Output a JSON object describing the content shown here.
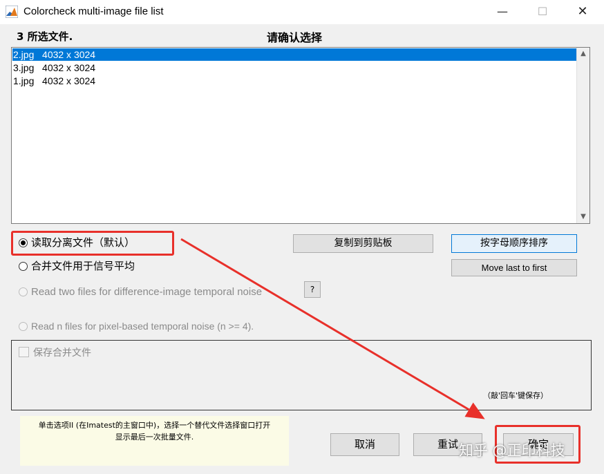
{
  "window": {
    "title": "Colorcheck  multi-image file list",
    "minimize_glyph": "—",
    "maximize_glyph": "☐",
    "close_glyph": "✕"
  },
  "header": {
    "file_count": "3 所选文件.",
    "confirm_title": "请确认选择"
  },
  "file_list": {
    "items": [
      "2.jpg   4032 x 3024",
      "3.jpg   4032 x 3024",
      "1.jpg   4032 x 3024"
    ],
    "selected_index": 0
  },
  "options": {
    "read_separate": "读取分离文件（默认）",
    "combine_average": "合并文件用于信号平均",
    "read_two_diff": "Read two files for difference-image temporal noise",
    "read_n_files": "Read n files for pixel-based temporal noise  (n >= 4).",
    "selected": "read_separate"
  },
  "buttons": {
    "copy_clipboard": "复制到剪贴板",
    "sort_alpha": "按字母顺序排序",
    "move_last_first": "Move last to first",
    "help": "?",
    "cancel": "取消",
    "retry": "重试",
    "ok": "确定"
  },
  "save_panel": {
    "save_combined": "保存合并文件",
    "enter_hint": "（敲'回车'键保存）"
  },
  "help_text": {
    "line1": "单击选项II (在Imatest的主窗口中)，选择一个替代文件选择窗口打开",
    "line2": "显示最后一次批量文件."
  },
  "watermark": {
    "text": "知乎 @正印科技"
  },
  "colors": {
    "selection": "#0078d7",
    "annotation": "#e8302a",
    "help_bg": "#fbfbe6",
    "window_bg": "#f0f0f0"
  }
}
